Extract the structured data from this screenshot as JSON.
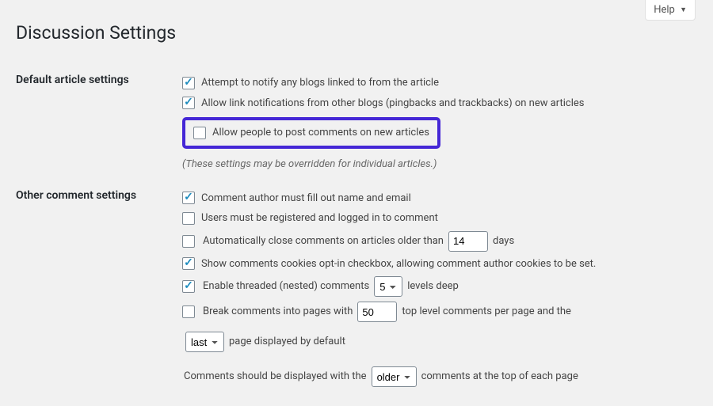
{
  "help": {
    "label": "Help"
  },
  "page_title": "Discussion Settings",
  "sections": {
    "default": {
      "heading": "Default article settings",
      "opt_notify": "Attempt to notify any blogs linked to from the article",
      "opt_pingback": "Allow link notifications from other blogs (pingbacks and trackbacks) on new articles",
      "opt_allow_comments": "Allow people to post comments on new articles",
      "hint": "(These settings may be overridden for individual articles.)"
    },
    "other": {
      "heading": "Other comment settings",
      "opt_name_email": "Comment author must fill out name and email",
      "opt_registered": "Users must be registered and logged in to comment",
      "opt_autoclose_pre": "Automatically close comments on articles older than",
      "opt_autoclose_days_value": "14",
      "opt_autoclose_post": "days",
      "opt_cookies": "Show comments cookies opt-in checkbox, allowing comment author cookies to be set.",
      "opt_threaded_pre": "Enable threaded (nested) comments",
      "opt_threaded_value": "5",
      "opt_threaded_post": "levels deep",
      "opt_paginate_pre": "Break comments into pages with",
      "opt_paginate_value": "50",
      "opt_paginate_mid": "top level comments per page and the",
      "opt_paginate_order_value": "last",
      "opt_paginate_post": "page displayed by default",
      "opt_display_pre": "Comments should be displayed with the",
      "opt_display_value": "older",
      "opt_display_post": "comments at the top of each page"
    }
  }
}
